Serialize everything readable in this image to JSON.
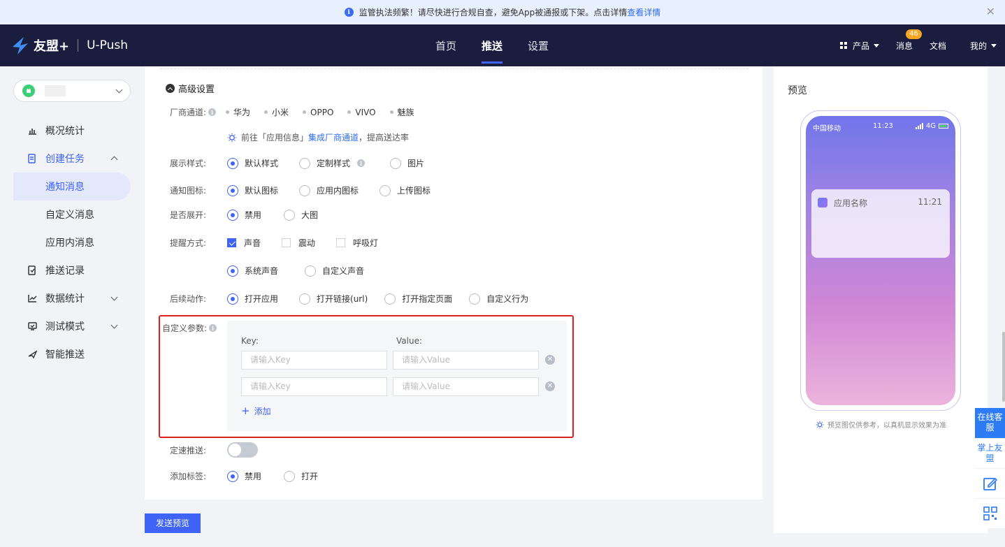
{
  "banner": {
    "text": "监管执法频繁！请尽快进行合规自查，避免App被通报或下架。点击详情",
    "link": "查看详情",
    "close": "✕"
  },
  "header": {
    "brand": "友盟+",
    "product": "U-Push",
    "nav": [
      "首页",
      "推送",
      "设置"
    ],
    "active_nav": "推送",
    "products": "产品",
    "messages": "消息",
    "message_count": "46",
    "docs": "文档",
    "mine": "我的"
  },
  "sidebar": {
    "items": [
      {
        "label": "概况统计"
      },
      {
        "label": "创建任务"
      },
      {
        "label": "通知消息"
      },
      {
        "label": "自定义消息"
      },
      {
        "label": "应用内消息"
      },
      {
        "label": "推送记录"
      },
      {
        "label": "数据统计"
      },
      {
        "label": "测试模式"
      },
      {
        "label": "智能推送"
      }
    ]
  },
  "form": {
    "advanced_title": "高级设置",
    "vendor": {
      "label": "厂商通道:",
      "options": [
        "华为",
        "小米",
        "OPPO",
        "VIVO",
        "魅族"
      ],
      "tip_prefix": "前往「应用信息」",
      "tip_link": "集成厂商通道",
      "tip_suffix": "，提高送达率"
    },
    "display_style": {
      "label": "展示样式:",
      "options": [
        "默认样式",
        "定制样式",
        "图片"
      ],
      "selected": "默认样式"
    },
    "notify_icon": {
      "label": "通知图标:",
      "options": [
        "默认图标",
        "应用内图标",
        "上传图标"
      ],
      "selected": "默认图标"
    },
    "expand": {
      "label": "是否展开:",
      "options": [
        "禁用",
        "大图"
      ],
      "selected": "禁用"
    },
    "reminder": {
      "label": "提醒方式:",
      "options": [
        "声音",
        "震动",
        "呼吸灯"
      ],
      "checked": [
        "声音"
      ],
      "sound_options": [
        "系统声音",
        "自定义声音"
      ],
      "sound_selected": "系统声音"
    },
    "follow_action": {
      "label": "后续动作:",
      "options": [
        "打开应用",
        "打开链接(url)",
        "打开指定页面",
        "自定义行为"
      ],
      "selected": "打开应用"
    },
    "custom_params": {
      "label": "自定义参数:",
      "key_header": "Key:",
      "value_header": "Value:",
      "key_placeholder": "请输入Key",
      "value_placeholder": "请输入Value",
      "rows": 2,
      "add": "添加"
    },
    "rate_push": {
      "label": "定速推送:",
      "enabled": false
    },
    "add_tag": {
      "label": "添加标签:",
      "options": [
        "禁用",
        "打开"
      ],
      "selected": "禁用"
    },
    "send_preview": "发送预览"
  },
  "preview": {
    "title": "预览",
    "carrier": "中国移动",
    "time": "11:23",
    "network": "4G",
    "app_name": "应用名称",
    "notif_time": "11:21",
    "tip": "预览图仅供参考，以真机显示效果为准"
  },
  "float_tools": {
    "service": "在线客服",
    "mobile": "掌上友盟"
  },
  "colors": {
    "primary": "#3e63f6",
    "header_bg": "#1a1d3d",
    "highlight": "#e02020"
  }
}
